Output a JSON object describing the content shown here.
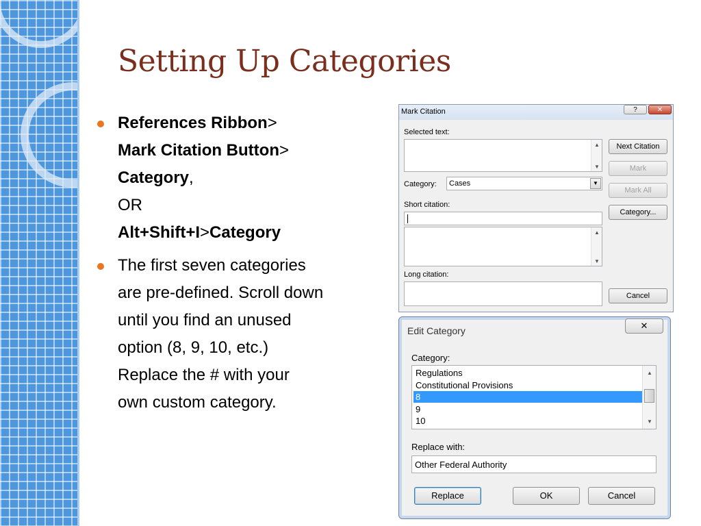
{
  "title": "Setting Up Categories",
  "bullets": {
    "b1": {
      "p1": "References Ribbon",
      "s1": ">",
      "p2": "Mark Citation Button",
      "s2": ">",
      "p3": "Category",
      "s3": ",",
      "p4": "OR",
      "p5": "Alt+Shift+I",
      "s5": ">",
      "p6": "Category"
    },
    "b2": {
      "l1": "The first seven categories",
      "l2": "are pre-defined. Scroll down",
      "l3": "until you find an unused",
      "l4": "option (8, 9, 10, etc.)",
      "l5": "Replace the # with your",
      "l6": "own custom category."
    }
  },
  "mark_citation": {
    "title": "Mark Citation",
    "help_btn": "?",
    "close_btn": "✕",
    "selected_text_label": "Selected text:",
    "category_label": "Category:",
    "category_value": "Cases",
    "short_citation_label": "Short citation:",
    "long_citation_label": "Long citation:",
    "buttons": {
      "next": "Next Citation",
      "mark": "Mark",
      "mark_all": "Mark All",
      "category": "Category...",
      "cancel": "Cancel"
    }
  },
  "edit_category": {
    "title": "Edit Category",
    "close_btn": "✕",
    "category_label": "Category:",
    "list": [
      "Regulations",
      "Constitutional Provisions",
      "8",
      "9",
      "10"
    ],
    "selected_index": 2,
    "replace_with_label": "Replace with:",
    "replace_with_value": "Other Federal Authority",
    "buttons": {
      "replace": "Replace",
      "ok": "OK",
      "cancel": "Cancel"
    }
  },
  "colors": {
    "title": "#7a2e1e",
    "bullet": "#e97722",
    "grid": "#4f97dd",
    "selection": "#3399ff"
  }
}
